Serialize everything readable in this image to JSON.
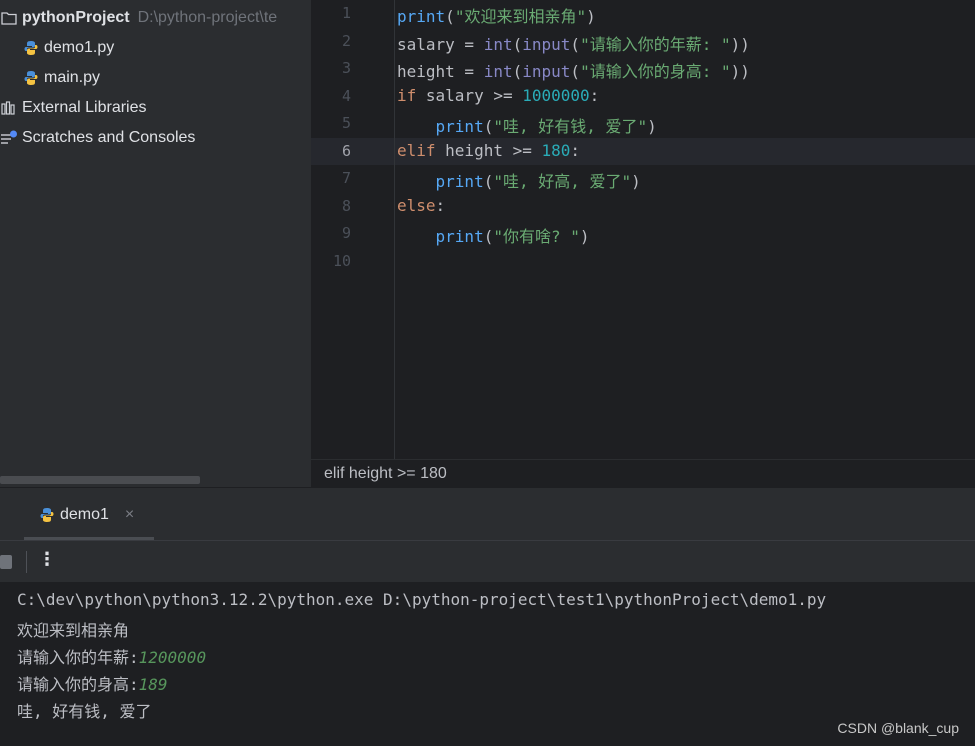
{
  "project_tree": {
    "root_name": "pythonProject",
    "root_path": "D:\\python-project\\te",
    "files": [
      "demo1.py",
      "main.py"
    ],
    "external_libraries": "External Libraries",
    "scratches": "Scratches and Consoles"
  },
  "editor": {
    "line_numbers": [
      "1",
      "2",
      "3",
      "4",
      "5",
      "6",
      "7",
      "8",
      "9",
      "10"
    ],
    "active_line": "6",
    "lines": [
      [
        [
          "fn",
          "print"
        ],
        [
          "pl",
          "("
        ],
        [
          "str",
          "\"欢迎来到相亲角\""
        ],
        [
          "pl",
          ")"
        ]
      ],
      [
        [
          "pl",
          "salary = "
        ],
        [
          "bi",
          "int"
        ],
        [
          "pl",
          "("
        ],
        [
          "bi",
          "input"
        ],
        [
          "pl",
          "("
        ],
        [
          "str",
          "\"请输入你的年薪: \""
        ],
        [
          "pl",
          "))"
        ]
      ],
      [
        [
          "pl",
          "height = "
        ],
        [
          "bi",
          "int"
        ],
        [
          "pl",
          "("
        ],
        [
          "bi",
          "input"
        ],
        [
          "pl",
          "("
        ],
        [
          "str",
          "\"请输入你的身高: \""
        ],
        [
          "pl",
          "))"
        ]
      ],
      [
        [
          "kw",
          "if"
        ],
        [
          "pl",
          " salary >= "
        ],
        [
          "num",
          "1000000"
        ],
        [
          "pl",
          ":"
        ]
      ],
      [
        [
          "pl",
          "    "
        ],
        [
          "fn",
          "print"
        ],
        [
          "pl",
          "("
        ],
        [
          "str",
          "\"哇, 好有钱, 爱了\""
        ],
        [
          "pl",
          ")"
        ]
      ],
      [
        [
          "kw",
          "elif"
        ],
        [
          "pl",
          " height >= "
        ],
        [
          "num",
          "180"
        ],
        [
          "pl",
          ":"
        ]
      ],
      [
        [
          "pl",
          "    "
        ],
        [
          "fn",
          "print"
        ],
        [
          "pl",
          "("
        ],
        [
          "str",
          "\"哇, 好高, 爱了\""
        ],
        [
          "pl",
          ")"
        ]
      ],
      [
        [
          "kw",
          "else"
        ],
        [
          "pl",
          ":"
        ]
      ],
      [
        [
          "pl",
          "    "
        ],
        [
          "fn",
          "print"
        ],
        [
          "pl",
          "("
        ],
        [
          "str",
          "\"你有啥? \""
        ],
        [
          "pl",
          ")"
        ]
      ],
      []
    ],
    "breadcrumb": "elif height >= 180"
  },
  "run_panel": {
    "tab_label": "demo1",
    "tab_close": "×",
    "more_icon": "⋮"
  },
  "console": {
    "command": "C:\\dev\\python\\python3.12.2\\python.exe D:\\python-project\\test1\\pythonProject\\demo1.py",
    "line1": "欢迎来到相亲角",
    "prompt_salary": "请输入你的年薪:",
    "input_salary": "1200000",
    "prompt_height": "请输入你的身高:",
    "input_height": "189",
    "result": "哇, 好有钱, 爱了"
  },
  "watermark": "CSDN @blank_cup",
  "colors": {
    "keyword": "#cf8e6d",
    "function": "#56a8f5",
    "builtin": "#8888c6",
    "string": "#6aab73",
    "number": "#2aacb8",
    "console_input": "#57965c"
  }
}
